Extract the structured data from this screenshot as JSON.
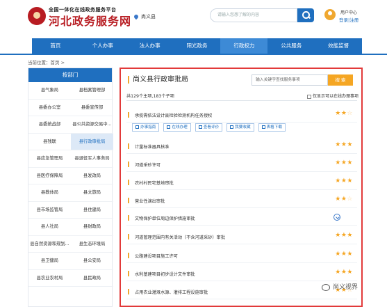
{
  "header": {
    "subtitle": "全国一体化在线政务服务平台",
    "title": "河北政务服务网",
    "location": "尚义县",
    "search_placeholder": "请输入您想了解的内容",
    "user_center": "用户中心",
    "login": "登录",
    "separator": "|",
    "register": "注册"
  },
  "nav": {
    "items": [
      "首页",
      "个人办事",
      "法人办事",
      "阳光政务",
      "行政权力",
      "公共服务",
      "效能监督"
    ],
    "active_index": 4
  },
  "breadcrumb": {
    "prefix": "当前位置：",
    "home": "首页",
    "sep": " > "
  },
  "departments": {
    "header": "按部门",
    "items": [
      "县气象局",
      "县档案管理部",
      "县委办公室",
      "县委宣传部",
      "县委统战部",
      "县公共资源交易中...",
      "县残联",
      "县行政审批局",
      "县应急管理局",
      "县退役军人事务局",
      "县医疗保障局",
      "县发改局",
      "县教体局",
      "县文旅局",
      "县市场监管局",
      "县住建局",
      "县人社局",
      "县财政局",
      "县自然资源和规划...",
      "县生态环境局",
      "县卫健局",
      "县公安局",
      "县农业农村局",
      "县民政局"
    ],
    "selected_index": 7
  },
  "main": {
    "title": "尚义县行政审批局",
    "search_placeholder": "输入关键字查找服务事项",
    "search_button": "搜 索",
    "stats": "共129个主项,183个子项",
    "filter_label": "仅显示可以在线办理事项",
    "actions": [
      "办事指南",
      "在线办理",
      "查看评价",
      "我要收藏",
      "表格下载"
    ],
    "items": [
      {
        "name": "承揽需依法设计县检验检测机构任务授权",
        "stars": 2
      },
      {
        "name": "计量标准器具核准",
        "stars": 3
      },
      {
        "name": "河道采砂许可",
        "stars": 3
      },
      {
        "name": "农村村民宅基地审批",
        "stars": 3
      },
      {
        "name": "营业性演出审批",
        "stars": 2
      },
      {
        "name": "文物保护单位周边保护措施审批",
        "stars": 0
      },
      {
        "name": "河道管理范围内有关活动（不含河道采砂）审批",
        "stars": 3
      },
      {
        "name": "公路建设项目施工许可",
        "stars": 3
      },
      {
        "name": "水利基建项目初步设计文件审批",
        "stars": 3
      },
      {
        "name": "占用农业灌溉水源、灌排工程设施审批",
        "stars": 2
      }
    ]
  },
  "watermark": "尚义视界"
}
